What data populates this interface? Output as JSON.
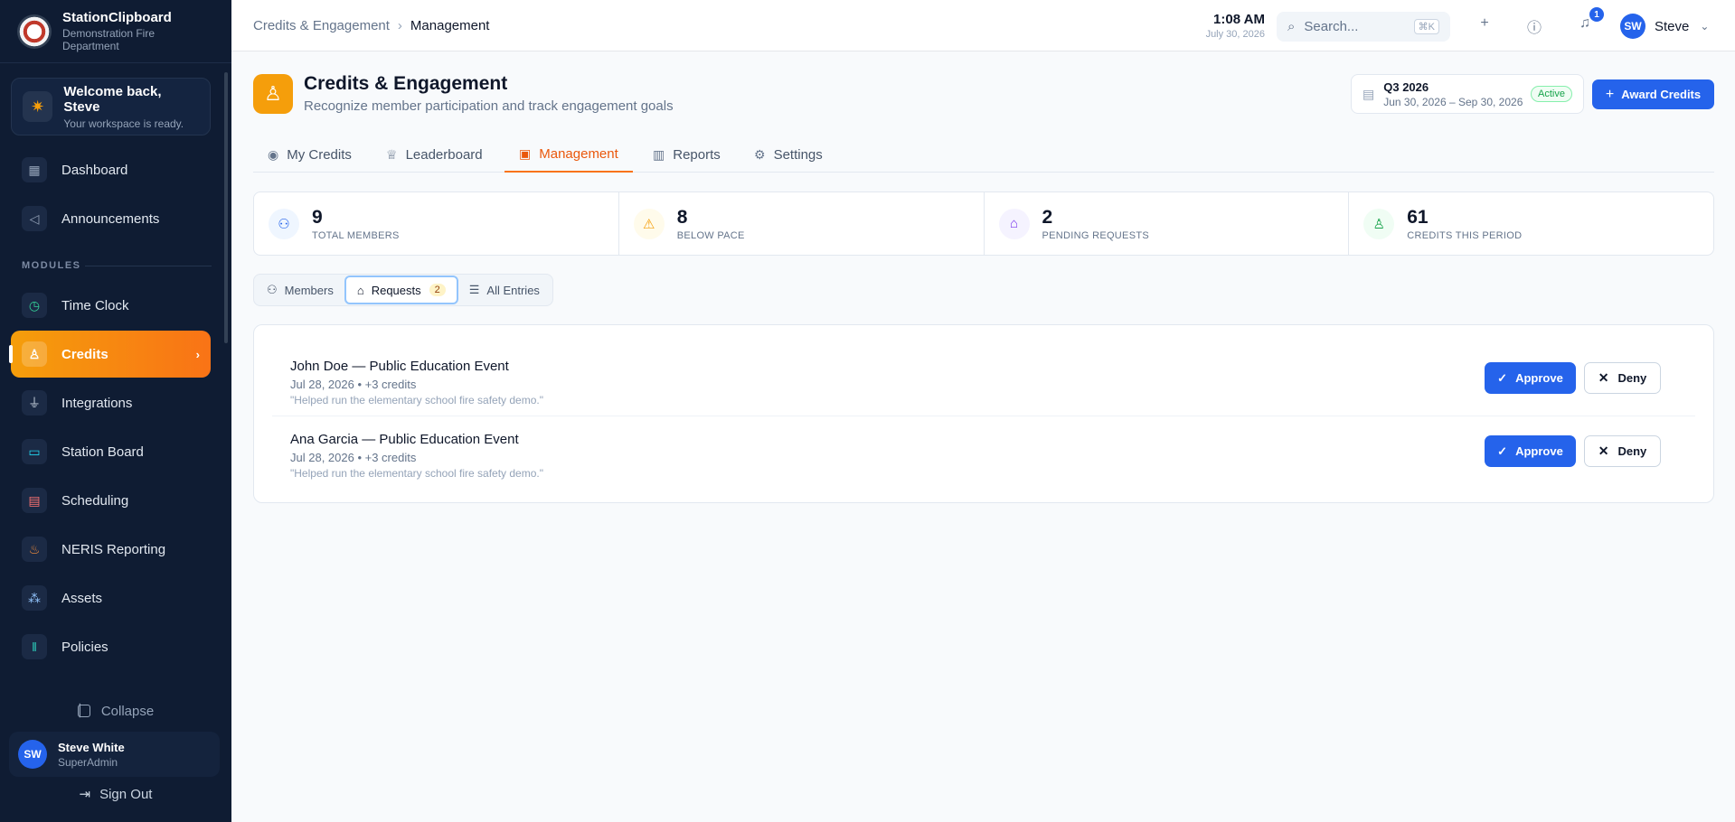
{
  "brand": {
    "name": "StationClipboard",
    "sub": "Demonstration Fire Department"
  },
  "welcome": {
    "title": "Welcome back, Steve",
    "sub": "Your workspace is ready."
  },
  "sidebar": {
    "section_label": "MODULES",
    "items": [
      {
        "label": "Dashboard",
        "icon": "grid-icon"
      },
      {
        "label": "Announcements",
        "icon": "megaphone-icon"
      },
      {
        "label": "Time Clock",
        "icon": "clock-icon"
      },
      {
        "label": "Credits",
        "icon": "award-icon",
        "active": true
      },
      {
        "label": "Integrations",
        "icon": "plug-icon"
      },
      {
        "label": "Station Board",
        "icon": "monitor-icon"
      },
      {
        "label": "Scheduling",
        "icon": "calendar-icon"
      },
      {
        "label": "NERIS Reporting",
        "icon": "flame-icon"
      },
      {
        "label": "Assets",
        "icon": "boxes-icon"
      },
      {
        "label": "Policies",
        "icon": "library-icon"
      }
    ],
    "collapse_label": "Collapse",
    "user": {
      "initials": "SW",
      "name": "Steve White",
      "role": "SuperAdmin"
    },
    "signout_label": "Sign Out"
  },
  "topbar": {
    "breadcrumb": [
      "Credits & Engagement",
      "Management"
    ],
    "time": "1:08 AM",
    "date": "July 30, 2026",
    "search_placeholder": "Search...",
    "search_shortcut": "⌘K",
    "notif_count": "1",
    "user": {
      "initials": "SW",
      "name": "Steve"
    }
  },
  "header": {
    "title": "Credits & Engagement",
    "subtitle": "Recognize member participation and track engagement goals",
    "period": {
      "name": "Q3 2026",
      "range": "Jun 30, 2026 – Sep 30, 2026",
      "status": "Active"
    },
    "award_label": "Award Credits"
  },
  "tabs": [
    {
      "label": "My Credits"
    },
    {
      "label": "Leaderboard"
    },
    {
      "label": "Management",
      "active": true
    },
    {
      "label": "Reports"
    },
    {
      "label": "Settings"
    }
  ],
  "stats": [
    {
      "value": "9",
      "label": "TOTAL MEMBERS",
      "color": "#2563eb"
    },
    {
      "value": "8",
      "label": "BELOW PACE",
      "color": "#f59e0b"
    },
    {
      "value": "2",
      "label": "PENDING REQUESTS",
      "color": "#7c3aed"
    },
    {
      "value": "61",
      "label": "CREDITS THIS PERIOD",
      "color": "#16a34a"
    }
  ],
  "subtabs": [
    {
      "label": "Members"
    },
    {
      "label": "Requests",
      "count": "2",
      "active": true
    },
    {
      "label": "All Entries"
    }
  ],
  "requests": [
    {
      "title": "John Doe — Public Education Event",
      "meta": "Jul 28, 2026 • +3 credits",
      "note": "\"Helped run the elementary school fire safety demo.\"",
      "approve_label": "Approve",
      "deny_label": "Deny"
    },
    {
      "title": "Ana Garcia — Public Education Event",
      "meta": "Jul 28, 2026 • +3 credits",
      "note": "\"Helped run the elementary school fire safety demo.\"",
      "approve_label": "Approve",
      "deny_label": "Deny"
    }
  ],
  "colors": {
    "accent": "#2563eb",
    "brand_orange": "#f59e0b",
    "sidebar_bg": "#0f1c33"
  }
}
